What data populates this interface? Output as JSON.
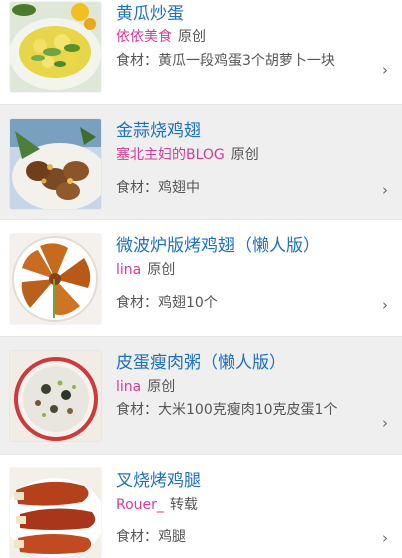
{
  "ingredients_prefix": "食材：",
  "items": [
    {
      "title": "黄瓜炒蛋",
      "author": "依依美食",
      "type": "原创",
      "ingredients": "黄瓜一段鸡蛋3个胡萝卜一块",
      "thumbnail_icon": "scrambled-egg-cucumber-photo",
      "chevron_icon": "chevron-right-icon"
    },
    {
      "title": "金蒜烧鸡翅",
      "author": "塞北主妇的BLOG",
      "type": "原创",
      "ingredients": "鸡翅中",
      "thumbnail_icon": "garlic-chicken-wings-photo",
      "chevron_icon": "chevron-right-icon"
    },
    {
      "title": "微波炉版烤鸡翅（懒人版）",
      "author": "lina",
      "type": "原创",
      "ingredients": "鸡翅10个",
      "thumbnail_icon": "roasted-chicken-wings-photo",
      "chevron_icon": "chevron-right-icon"
    },
    {
      "title": "皮蛋瘦肉粥（懒人版）",
      "author": "lina",
      "type": "原创",
      "ingredients": "大米100克瘦肉10克皮蛋1个",
      "thumbnail_icon": "congee-bowl-photo",
      "chevron_icon": "chevron-right-icon"
    },
    {
      "title": "叉烧烤鸡腿",
      "author": "Rouer_",
      "type": "转载",
      "ingredients": "鸡腿",
      "thumbnail_icon": "bbq-chicken-drumstick-photo",
      "chevron_icon": "chevron-right-icon"
    }
  ]
}
